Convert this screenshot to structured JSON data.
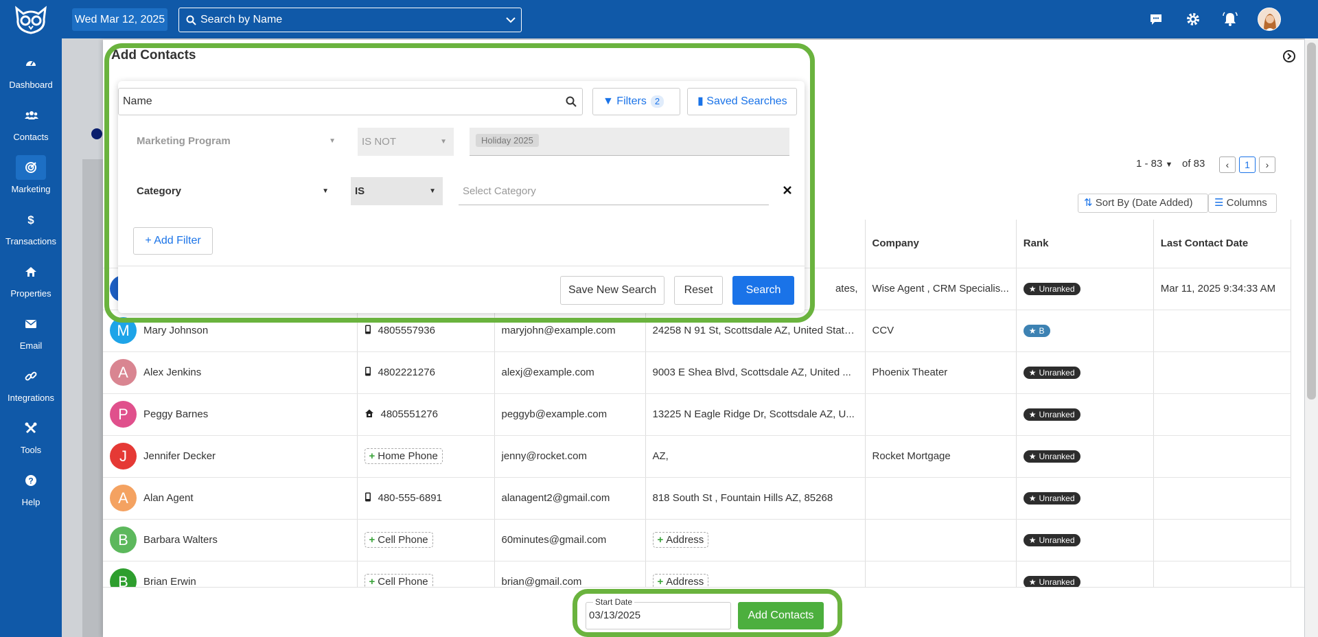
{
  "header": {
    "date": "Wed Mar 12, 2025",
    "search_placeholder": "Search by Name"
  },
  "sidebar": {
    "items": [
      {
        "label": "Dashboard",
        "icon": "dashboard-icon"
      },
      {
        "label": "Contacts",
        "icon": "contacts-icon"
      },
      {
        "label": "Marketing",
        "icon": "marketing-icon",
        "active": true
      },
      {
        "label": "Transactions",
        "icon": "dollar-icon"
      },
      {
        "label": "Properties",
        "icon": "home-icon"
      },
      {
        "label": "Email",
        "icon": "envelope-icon"
      },
      {
        "label": "Integrations",
        "icon": "link-icon"
      },
      {
        "label": "Tools",
        "icon": "tools-icon"
      },
      {
        "label": "Help",
        "icon": "help-icon"
      }
    ]
  },
  "panel": {
    "title": "Add Contacts"
  },
  "search": {
    "name_value": "Name",
    "filters_label": "Filters",
    "filters_count": "2",
    "saved_label": "Saved Searches"
  },
  "filters": [
    {
      "field": "Marketing Program",
      "operator": "IS NOT",
      "value": "Holiday 2025"
    },
    {
      "field": "Category",
      "operator": "IS",
      "placeholder": "Select Category"
    }
  ],
  "filter_actions": {
    "add_filter": "+ Add Filter",
    "save_new": "Save New Search",
    "reset": "Reset",
    "search": "Search"
  },
  "toolbar": {
    "range": "1 - 83",
    "of_total": "of 83",
    "page": "1",
    "sort_label": "Sort By (Date Added)",
    "columns_label": "Columns"
  },
  "table": {
    "headers": [
      "",
      "",
      "",
      "",
      "Company",
      "Rank",
      "Last Contact Date"
    ],
    "first_row_address_tail": "ates,",
    "first_row_company": "Wise Agent , CRM Specialis...",
    "first_row_rank": "Unranked",
    "first_row_date": "Mar 11, 2025 9:34:33 AM",
    "rows": [
      {
        "initial": "M",
        "color": "#1ea4e8",
        "name": "Mary Johnson",
        "phone_icon": "mobile",
        "phone": "4805557936",
        "email": "maryjohn@example.com",
        "address": "24258 N 91 St, Scottsdale AZ, United State...",
        "company": "CCV",
        "rank": "B"
      },
      {
        "initial": "A",
        "color": "#d98591",
        "name": "Alex Jenkins",
        "phone_icon": "mobile",
        "phone": "4802221276",
        "email": "alexj@example.com",
        "address": "9003 E Shea Blvd, Scottsdale AZ, United ...",
        "company": "Phoenix Theater",
        "rank": "Unranked"
      },
      {
        "initial": "P",
        "color": "#e0508c",
        "name": "Peggy Barnes",
        "phone_icon": "home",
        "phone": "4805551276",
        "email": "peggyb@example.com",
        "address": "13225 N Eagle Ridge Dr, Scottsdale AZ, U...",
        "company": "",
        "rank": "Unranked"
      },
      {
        "initial": "J",
        "color": "#e53935",
        "name": "Jennifer Decker",
        "phone_icon": "add",
        "phone": "Home Phone",
        "email": "jenny@rocket.com",
        "address": "AZ,",
        "company": "Rocket Mortgage",
        "rank": "Unranked"
      },
      {
        "initial": "A",
        "color": "#f4a261",
        "name": "Alan Agent",
        "phone_icon": "mobile",
        "phone": "480-555-6891",
        "email": "alanagent2@gmail.com",
        "address": "818 South St , Fountain Hills AZ, 85268",
        "company": "",
        "rank": "Unranked"
      },
      {
        "initial": "B",
        "color": "#5cb85c",
        "name": "Barbara Walters",
        "phone_icon": "add",
        "phone": "Cell Phone",
        "email": "60minutes@gmail.com",
        "address": "Address",
        "address_add": true,
        "company": "",
        "rank": "Unranked"
      },
      {
        "initial": "B",
        "color": "#2e9e2e",
        "name": "Brian Erwin",
        "phone_icon": "add",
        "phone": "Cell Phone",
        "email": "brian@gmail.com",
        "address": "Address",
        "address_add": true,
        "company": "",
        "rank": "Unranked"
      }
    ]
  },
  "footer": {
    "start_date_label": "Start Date",
    "start_date_value": "03/13/2025",
    "add_button": "Add Contacts"
  }
}
